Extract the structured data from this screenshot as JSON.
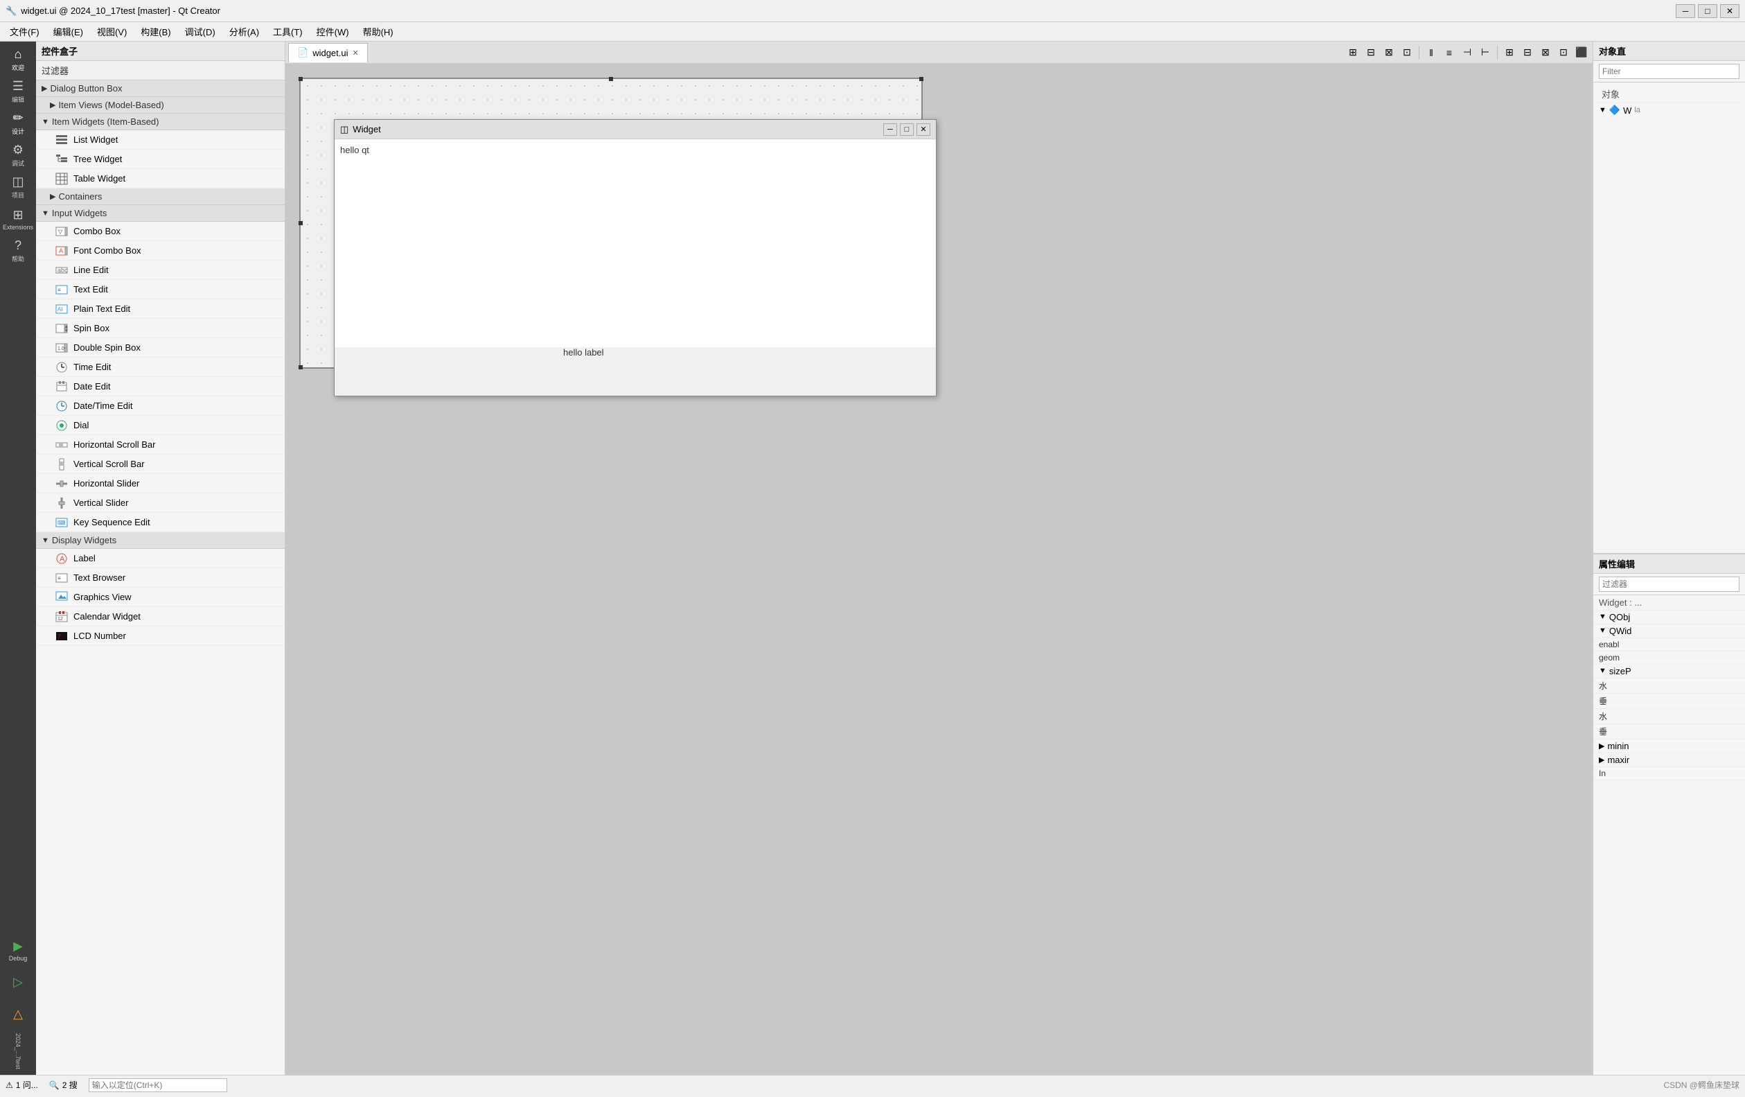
{
  "titlebar": {
    "title": "widget.ui @ 2024_10_17test [master] - Qt Creator",
    "minimize": "─",
    "maximize": "□",
    "close": "✕"
  },
  "menubar": {
    "items": [
      {
        "label": "文件(F)"
      },
      {
        "label": "编辑(E)"
      },
      {
        "label": "视图(V)"
      },
      {
        "label": "构建(B)"
      },
      {
        "label": "调试(D)"
      },
      {
        "label": "分析(A)"
      },
      {
        "label": "工具(T)"
      },
      {
        "label": "控件(W)"
      },
      {
        "label": "帮助(H)"
      }
    ]
  },
  "activity_bar": {
    "items": [
      {
        "label": "欢迎",
        "icon": "⌂"
      },
      {
        "label": "编辑",
        "icon": "☰"
      },
      {
        "label": "设计",
        "icon": "✏"
      },
      {
        "label": "调试",
        "icon": "⚙"
      },
      {
        "label": "项目",
        "icon": "◫"
      },
      {
        "label": "Extensions",
        "icon": "⊞"
      },
      {
        "label": "帮助",
        "icon": "?"
      },
      {
        "label": "Debug",
        "icon": "▶"
      },
      {
        "label": "",
        "icon": "▷"
      },
      {
        "label": "",
        "icon": "△"
      }
    ]
  },
  "toolbox": {
    "title": "控件盒子",
    "filter_label": "过滤器",
    "categories": [
      {
        "name": "dialog-button-box-category",
        "label": "Dialog Button Box",
        "expanded": false,
        "arrow": "▶"
      },
      {
        "name": "item-views-category",
        "label": "Item Views (Model-Based)",
        "expanded": false,
        "arrow": "▶"
      },
      {
        "name": "item-widgets-category",
        "label": "Item Widgets (Item-Based)",
        "expanded": true,
        "arrow": "▼",
        "items": [
          {
            "label": "List Widget",
            "icon": "☰"
          },
          {
            "label": "Tree Widget",
            "icon": "☷"
          },
          {
            "label": "Table Widget",
            "icon": "⊞"
          }
        ]
      },
      {
        "name": "containers-category",
        "label": "Containers",
        "expanded": false,
        "arrow": "▶"
      },
      {
        "name": "input-widgets-category",
        "label": "Input Widgets",
        "expanded": true,
        "arrow": "▼",
        "items": [
          {
            "label": "Combo Box",
            "icon": "▽"
          },
          {
            "label": "Font Combo Box",
            "icon": "▽"
          },
          {
            "label": "Line Edit",
            "icon": "▭"
          },
          {
            "label": "Text Edit",
            "icon": "▣"
          },
          {
            "label": "Plain Text Edit",
            "icon": "▣"
          },
          {
            "label": "Spin Box",
            "icon": "⊕"
          },
          {
            "label": "Double Spin Box",
            "icon": "⊕"
          },
          {
            "label": "Time Edit",
            "icon": "⊙"
          },
          {
            "label": "Date Edit",
            "icon": "📅"
          },
          {
            "label": "Date/Time Edit",
            "icon": "⊙"
          },
          {
            "label": "Dial",
            "icon": "◎"
          },
          {
            "label": "Horizontal Scroll Bar",
            "icon": "↔"
          },
          {
            "label": "Vertical Scroll Bar",
            "icon": "↕"
          },
          {
            "label": "Horizontal Slider",
            "icon": "⊟"
          },
          {
            "label": "Vertical Slider",
            "icon": "⊟"
          },
          {
            "label": "Key Sequence Edit",
            "icon": "⌨"
          }
        ]
      },
      {
        "name": "display-widgets-category",
        "label": "Display Widgets",
        "expanded": true,
        "arrow": "▼",
        "items": [
          {
            "label": "Label",
            "icon": "A"
          },
          {
            "label": "Text Browser",
            "icon": "▣"
          },
          {
            "label": "Graphics View",
            "icon": "◰"
          },
          {
            "label": "Calendar Widget",
            "icon": "📅"
          },
          {
            "label": "LCD Number",
            "icon": "7"
          }
        ]
      }
    ]
  },
  "editor": {
    "tab_label": "widget.ui",
    "canvas": {
      "label1": "hello label",
      "label2": "hello label"
    },
    "widget_window": {
      "title": "Widget",
      "icon": "◫",
      "content_label": "hello qt",
      "hello_label": "hello label"
    }
  },
  "right_panel": {
    "title": "对象直",
    "filter_placeholder": "Filter",
    "object_label": "对象",
    "tree": {
      "item1": "W",
      "item1_sub": "la"
    },
    "props_title": "属性编辑",
    "props_filter_placeholder": "过滤器",
    "props_object_label": "Widget : ...",
    "sections": [
      {
        "label": "QObj",
        "arrow": "▼"
      },
      {
        "label": "QWid",
        "arrow": "▼"
      },
      {
        "label": "enabl",
        "arrow": ""
      },
      {
        "label": "geom",
        "arrow": ""
      },
      {
        "label": "sizeP",
        "arrow": "▼"
      },
      {
        "label": "水",
        "arrow": ""
      },
      {
        "label": "垂",
        "arrow": ""
      },
      {
        "label": "水",
        "arrow": ""
      },
      {
        "label": "垂",
        "arrow": ""
      },
      {
        "label": "minin",
        "arrow": "▶"
      },
      {
        "label": "maxir",
        "arrow": "▶"
      },
      {
        "label": "In",
        "arrow": ""
      }
    ]
  },
  "statusbar": {
    "item1": "1 问...",
    "item2": "2 搜",
    "search_placeholder": "输入以定位(Ctrl+K)",
    "watermark": "CSDN @鳄鱼床垫球"
  }
}
